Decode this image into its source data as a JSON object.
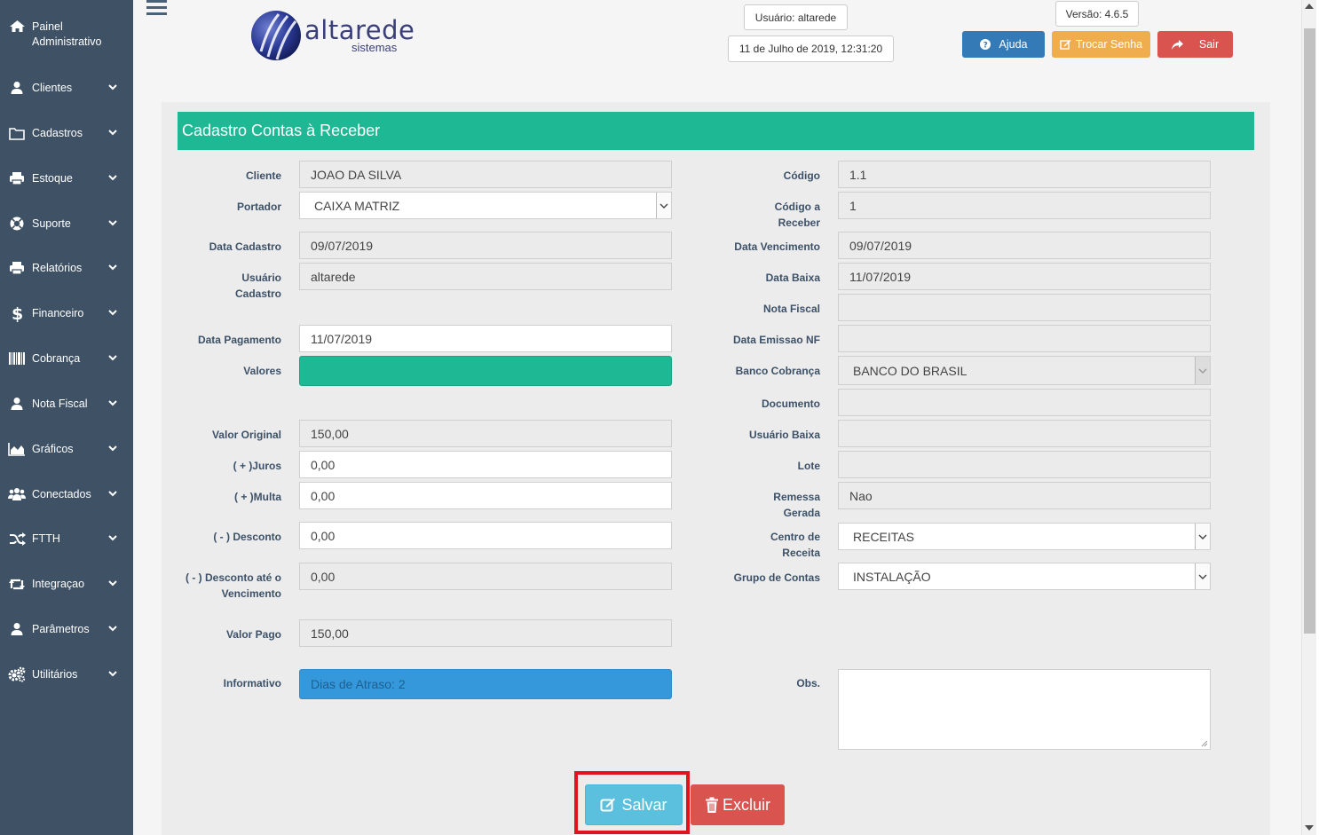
{
  "sidebar": {
    "header": "Painel Administrativo",
    "items": [
      {
        "label": "Clientes",
        "icon": "user-icon"
      },
      {
        "label": "Cadastros",
        "icon": "folder-icon"
      },
      {
        "label": "Estoque",
        "icon": "printer-icon"
      },
      {
        "label": "Suporte",
        "icon": "life-ring-icon"
      },
      {
        "label": "Relatórios",
        "icon": "printer-icon"
      },
      {
        "label": "Financeiro",
        "icon": "dollar-icon"
      },
      {
        "label": "Cobrança",
        "icon": "barcode-icon"
      },
      {
        "label": "Nota Fiscal",
        "icon": "user-icon"
      },
      {
        "label": "Gráficos",
        "icon": "area-chart-icon"
      },
      {
        "label": "Conectados",
        "icon": "users-icon"
      },
      {
        "label": "FTTH",
        "icon": "random-icon"
      },
      {
        "label": "Integraçao",
        "icon": "retweet-icon"
      },
      {
        "label": "Parâmetros",
        "icon": "user-icon"
      },
      {
        "label": "Utilitários",
        "icon": "cogs-icon"
      }
    ]
  },
  "header": {
    "logo_word": "altarede",
    "logo_sub": "sistemas",
    "user": "Usuário: altarede",
    "datetime": "11 de Julho de 2019, 12:31:20",
    "version": "Versão: 4.6.5",
    "help_label": "Ajuda",
    "change_password_label": "Trocar Senha",
    "logout_label": "Sair"
  },
  "form": {
    "title": "Cadastro Contas à Receber",
    "left": {
      "cliente_label": "Cliente",
      "cliente": "JOAO DA SILVA",
      "portador_label": "Portador",
      "portador": "CAIXA MATRIZ",
      "data_cadastro_label": "Data Cadastro",
      "data_cadastro": "09/07/2019",
      "usuario_cadastro_label": "Usuário Cadastro",
      "usuario_cadastro": "altarede",
      "data_pagamento_label": "Data Pagamento",
      "data_pagamento": "11/07/2019",
      "valores_label": "Valores",
      "valor_original_label": "Valor Original",
      "valor_original": "150,00",
      "juros_label": "( + )Juros",
      "juros": "0,00",
      "multa_label": "( + )Multa",
      "multa": "0,00",
      "desconto_label": "( - ) Desconto",
      "desconto": "0,00",
      "desconto_venc_label": "( - ) Desconto até o Vencimento",
      "desconto_venc": "0,00",
      "valor_pago_label": "Valor Pago",
      "valor_pago": "150,00",
      "informativo_label": "Informativo",
      "informativo": "Dias de Atraso: 2"
    },
    "right": {
      "codigo_label": "Código",
      "codigo": "1.1",
      "codigo_receber_label": "Código a Receber",
      "codigo_receber": "1",
      "data_vencimento_label": "Data Vencimento",
      "data_vencimento": "09/07/2019",
      "data_baixa_label": "Data Baixa",
      "data_baixa": "11/07/2019",
      "nota_fiscal_label": "Nota Fiscal",
      "nota_fiscal": "",
      "data_emissao_nf_label": "Data Emissao NF",
      "data_emissao_nf": "",
      "banco_cobranca_label": "Banco Cobrança",
      "banco_cobranca": "BANCO DO BRASIL",
      "documento_label": "Documento",
      "documento": "",
      "usuario_baixa_label": "Usuário Baixa",
      "usuario_baixa": "",
      "lote_label": "Lote",
      "lote": "",
      "remessa_label": "Remessa Gerada",
      "remessa": "Nao",
      "centro_receita_label": "Centro de Receita",
      "centro_receita": "RECEITAS",
      "grupo_contas_label": "Grupo de Contas",
      "grupo_contas": "INSTALAÇÃO",
      "obs_label": "Obs."
    },
    "save_label": "Salvar",
    "delete_label": "Excluir"
  },
  "colors": {
    "sidebar_bg": "#3e5165",
    "title_bar": "#1fb894",
    "help_btn": "#337ab7",
    "password_btn": "#f0ad4e",
    "logout_btn": "#d9534f",
    "info_field": "#3498db",
    "save_btn": "#5bc0de",
    "highlight_frame": "#e0141f"
  }
}
